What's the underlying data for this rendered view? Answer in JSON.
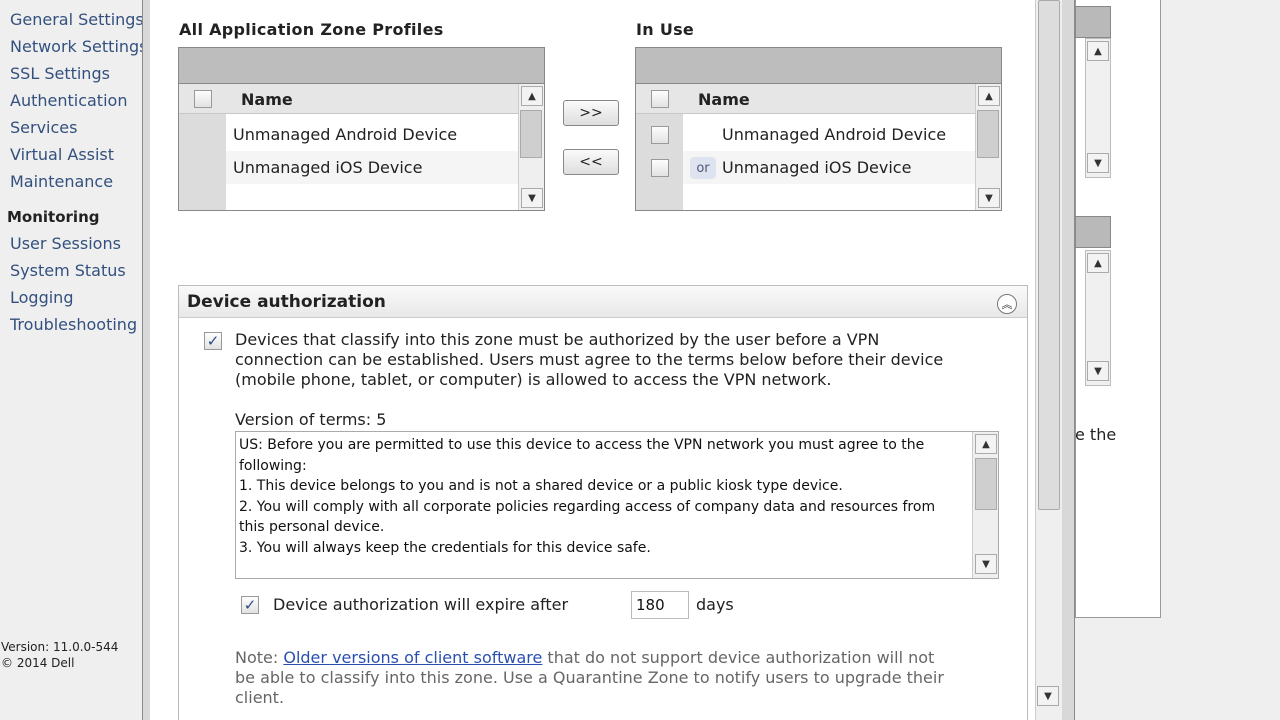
{
  "sidebar": {
    "items": [
      {
        "label": "General Settings"
      },
      {
        "label": "Network Settings"
      },
      {
        "label": "SSL Settings"
      },
      {
        "label": "Authentication"
      },
      {
        "label": "Services"
      },
      {
        "label": "Virtual Assist"
      },
      {
        "label": "Maintenance"
      }
    ],
    "monitoring_heading": "Monitoring",
    "monitoring_items": [
      {
        "label": "User Sessions"
      },
      {
        "label": "System Status"
      },
      {
        "label": "Logging"
      },
      {
        "label": "Troubleshooting"
      }
    ],
    "version": "Version: 11.0.0-544",
    "copyright": "© 2014 Dell"
  },
  "background": {
    "text_fragment": "e the"
  },
  "profiles": {
    "all_label": "All Application Zone Profiles",
    "in_use_label": "In Use",
    "name_header": "Name",
    "all_items": [
      "Unmanaged Android Device",
      "Unmanaged iOS Device"
    ],
    "in_use_items": [
      "Unmanaged Android Device",
      "Unmanaged iOS Device"
    ],
    "or_badge": "or",
    "add_button": ">>",
    "remove_button": "<<"
  },
  "device_auth": {
    "title": "Device authorization",
    "require_checked": true,
    "require_line1": "Devices that classify into this zone must be authorized by the user before a VPN",
    "require_line2": "connection can be established. Users must agree to the terms below before their device",
    "require_line3": "(mobile phone, tablet, or computer) is allowed to access the VPN network.",
    "version_label": "Version of terms: 5",
    "terms_text": "US: Before you are permitted to use this device to access the VPN network you must agree to the following:\n1. This device belongs to you and is not a shared device or a public kiosk type device.\n2. You will comply with all corporate policies regarding access of company data and resources from this personal device.\n3. You will always keep the credentials for this device safe.",
    "expire_checked": true,
    "expire_label": "Device authorization will expire after",
    "expire_days": "180",
    "days_unit": "days",
    "note_prefix": "Note: ",
    "note_link": "Older versions of client software",
    "note_line1_rest": " that do not support device authorization will not",
    "note_line2": "be able to classify into this zone. Use a Quarantine Zone to notify users to upgrade their",
    "note_line3": "client."
  }
}
